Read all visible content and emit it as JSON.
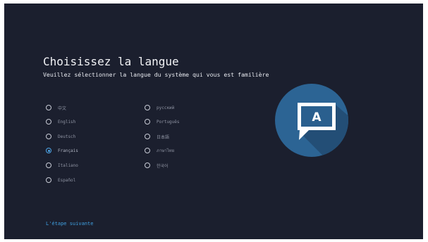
{
  "page": {
    "title": "Choisissez la langue",
    "subtitle": "Veuillez sélectionner la langue du système qui vous est familière"
  },
  "languages": {
    "left": [
      {
        "label": "中文",
        "selected": false
      },
      {
        "label": "English",
        "selected": false
      },
      {
        "label": "Deutsch",
        "selected": false
      },
      {
        "label": "Français",
        "selected": true
      },
      {
        "label": "Italiano",
        "selected": false
      },
      {
        "label": "Español",
        "selected": false
      }
    ],
    "right": [
      {
        "label": "русский",
        "selected": false
      },
      {
        "label": "Português",
        "selected": false
      },
      {
        "label": "日本語",
        "selected": false
      },
      {
        "label": "ภาษาไทย",
        "selected": false
      },
      {
        "label": "한국어",
        "selected": false
      }
    ]
  },
  "footer": {
    "next_label": "L'étape suivante"
  },
  "illustration": {
    "icon": "language-speech-bubble-icon",
    "glyph": "A"
  },
  "colors": {
    "background": "#1b1f2e",
    "accent": "#3f9fe0",
    "circle": "#2c6494",
    "long_shadow": "#234e76",
    "bubble": "#ffffff",
    "screen_fill": "#2a5f8e"
  }
}
